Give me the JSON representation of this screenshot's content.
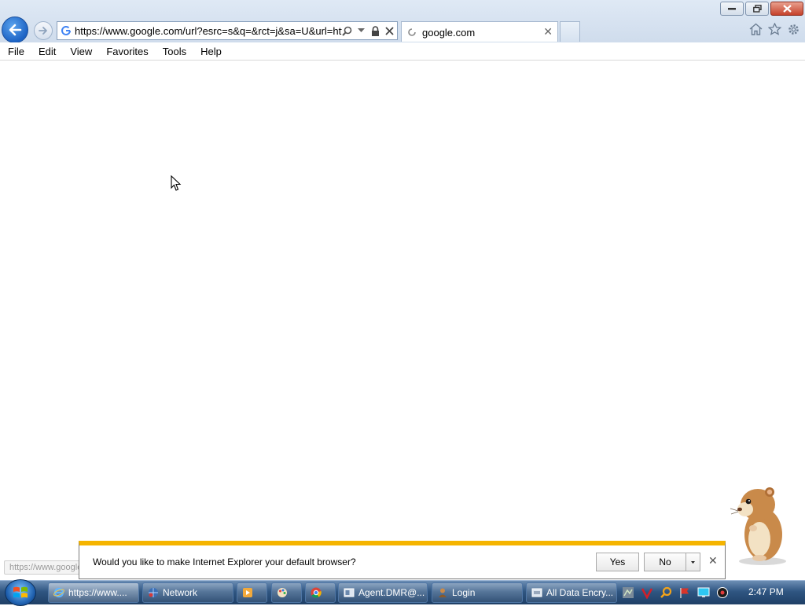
{
  "browser": {
    "address": {
      "url": "https://www.google.com/url?esrc=s&q=&rct=j&sa=U&url=http"
    },
    "tab": {
      "title": "google.com"
    }
  },
  "menu": {
    "items": [
      {
        "label": "File"
      },
      {
        "label": "Edit"
      },
      {
        "label": "View"
      },
      {
        "label": "Favorites"
      },
      {
        "label": "Tools"
      },
      {
        "label": "Help"
      }
    ]
  },
  "status": {
    "url_text": "https://www.google.com/url?esrc=s&q=&rct=j&sa=U&url=https://www.google.com/&ve..."
  },
  "notification": {
    "message": "Would you like to make Internet Explorer your default browser?",
    "yes_label": "Yes",
    "no_label": "No"
  },
  "taskbar": {
    "items": [
      {
        "label": "https://www...."
      },
      {
        "label": "Network"
      },
      {
        "label": ""
      },
      {
        "label": ""
      },
      {
        "label": ""
      },
      {
        "label": "Agent.DMR@..."
      },
      {
        "label": "Login"
      },
      {
        "label": "All Data Encry..."
      }
    ],
    "clock": "2:47 PM"
  },
  "colors": {
    "notification_accent": "#f5b400",
    "back_button": "#1d63c4",
    "taskbar": "#2f5682"
  }
}
